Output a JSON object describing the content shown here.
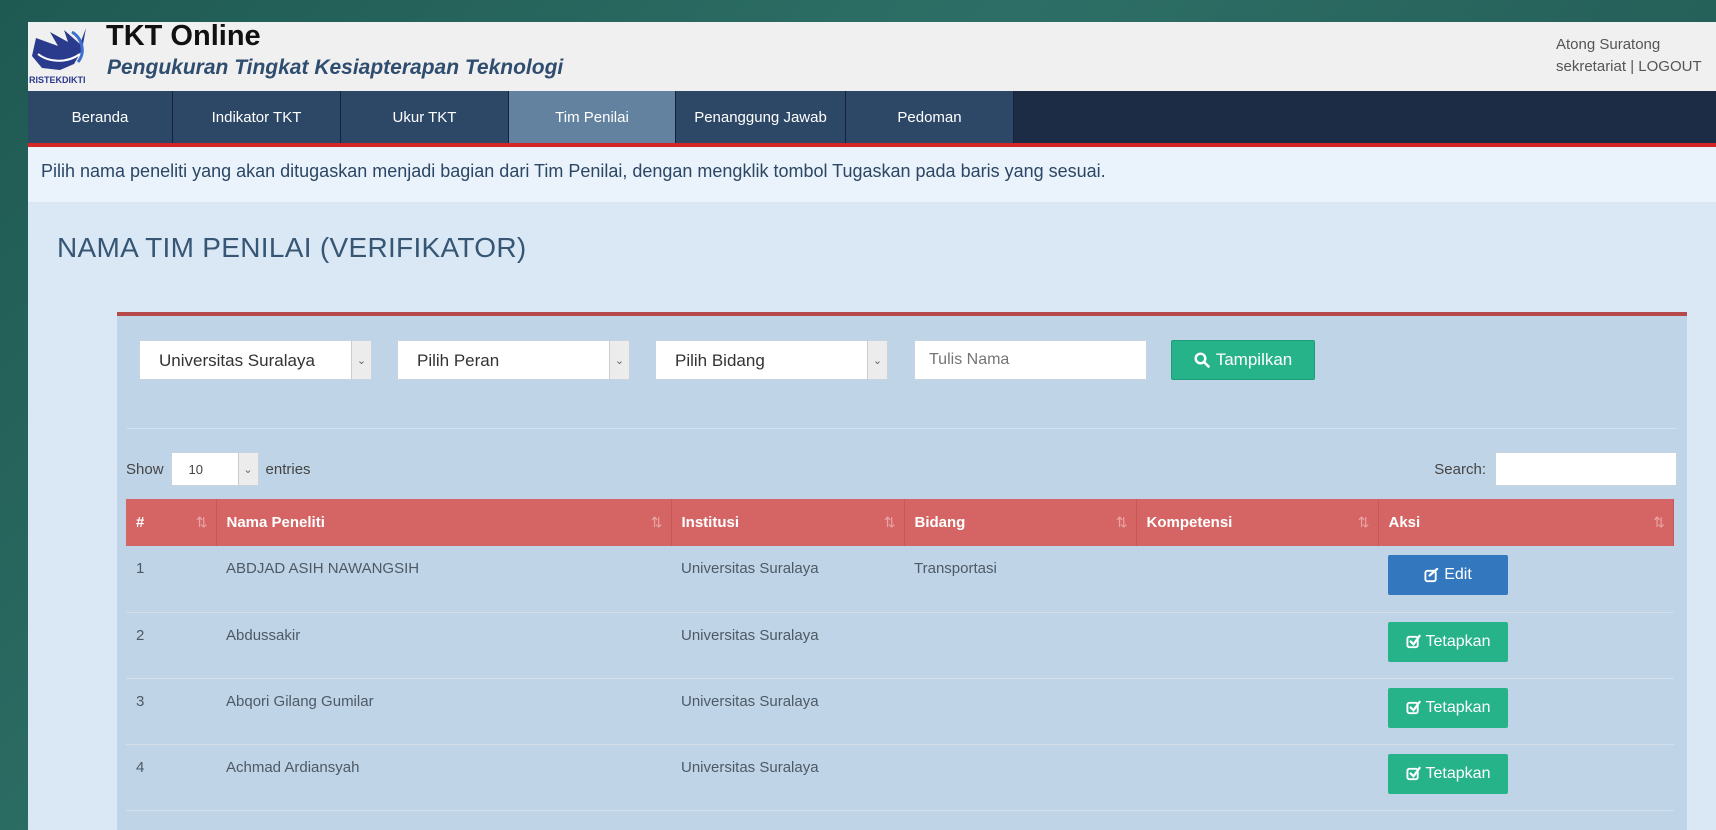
{
  "header": {
    "logo_text": "RISTEKDIKTI",
    "title": "TKT Online",
    "subtitle": "Pengukuran Tingkat Kesiapterapan Teknologi",
    "user_name": "Atong Suratong",
    "user_role": "sekretariat",
    "separator": "|",
    "logout_label": "LOGOUT"
  },
  "nav": {
    "items": [
      {
        "label": "Beranda"
      },
      {
        "label": "Indikator TKT"
      },
      {
        "label": "Ukur TKT"
      },
      {
        "label": "Tim Penilai"
      },
      {
        "label": "Penanggung Jawab"
      },
      {
        "label": "Pedoman"
      }
    ],
    "active": "Tim Penilai"
  },
  "instruction": "Pilih nama peneliti yang akan ditugaskan menjadi bagian dari Tim Penilai, dengan mengklik tombol Tugaskan pada baris yang sesuai.",
  "panel": {
    "title": "NAMA TIM PENILAI (VERIFIKATOR)"
  },
  "filters": {
    "institusi": "Universitas Suralaya",
    "peran": "Pilih Peran",
    "bidang": "Pilih Bidang",
    "nama_placeholder": "Tulis Nama",
    "button_label": "Tampilkan"
  },
  "table_controls": {
    "show_label": "Show",
    "entries_value": "10",
    "entries_label": "entries",
    "search_label": "Search:"
  },
  "table": {
    "headers": [
      "#",
      "Nama Peneliti",
      "Institusi",
      "Bidang",
      "Kompetensi",
      "Aksi"
    ],
    "rows": [
      {
        "no": "1",
        "nama": "ABDJAD ASIH NAWANGSIH",
        "institusi": "Universitas Suralaya",
        "bidang": "Transportasi",
        "kompetensi": "",
        "aksi": "Edit"
      },
      {
        "no": "2",
        "nama": "Abdussakir",
        "institusi": "Universitas Suralaya",
        "bidang": "",
        "kompetensi": "",
        "aksi": "Tetapkan"
      },
      {
        "no": "3",
        "nama": "Abqori Gilang Gumilar",
        "institusi": "Universitas Suralaya",
        "bidang": "",
        "kompetensi": "",
        "aksi": "Tetapkan"
      },
      {
        "no": "4",
        "nama": "Achmad Ardiansyah",
        "institusi": "Universitas Suralaya",
        "bidang": "",
        "kompetensi": "",
        "aksi": "Tetapkan"
      }
    ]
  },
  "colors": {
    "nav_bg": "#1c2c45",
    "nav_active": "#63829f",
    "accent_red": "#d32525",
    "table_header": "#d56565",
    "btn_green": "#27b38a",
    "btn_blue": "#3378be"
  },
  "icons": {
    "search": "search-icon",
    "edit": "edit-check-icon",
    "sort": "sort-icon"
  }
}
